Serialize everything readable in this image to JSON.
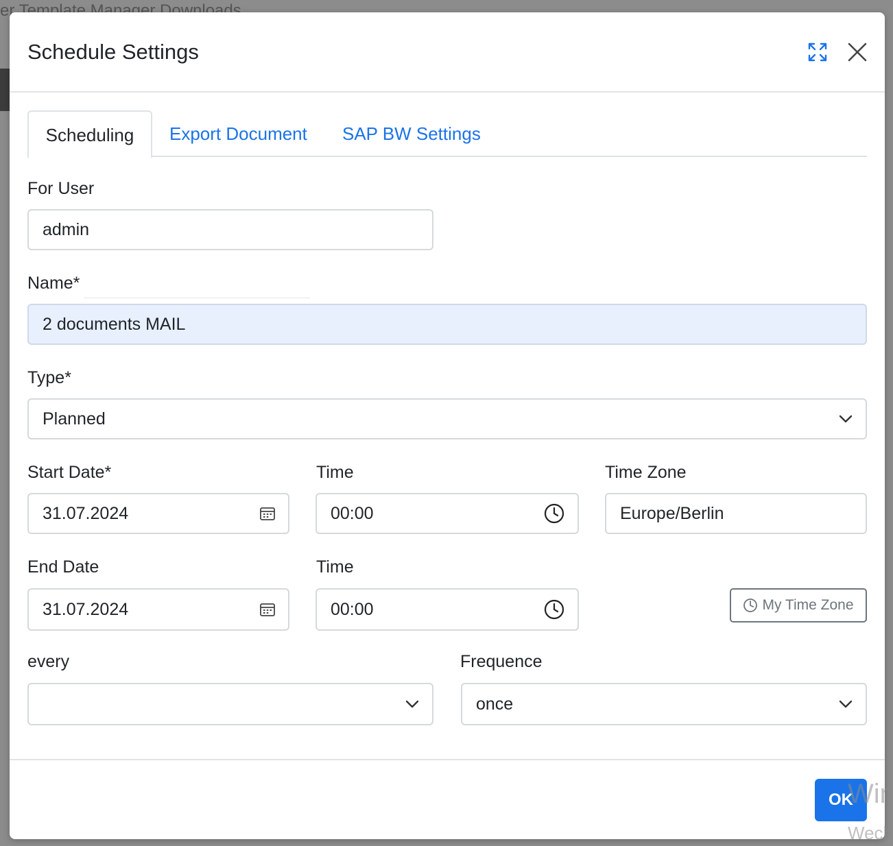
{
  "background": {
    "breadcrumb": "er Template Manager Downloads"
  },
  "modal": {
    "title": "Schedule Settings",
    "tabs": [
      {
        "label": "Scheduling",
        "active": true
      },
      {
        "label": "Export Document",
        "active": false
      },
      {
        "label": "SAP BW Settings",
        "active": false
      }
    ],
    "for_user": {
      "label": "For User",
      "value": "admin"
    },
    "name": {
      "label": "Name*",
      "value": "2 documents MAIL"
    },
    "type": {
      "label": "Type*",
      "value": "Planned"
    },
    "start_date": {
      "label": "Start Date*",
      "value": "31.07.2024"
    },
    "start_time": {
      "label": "Time",
      "value": "00:00"
    },
    "time_zone": {
      "label": "Time Zone",
      "value": "Europe/Berlin"
    },
    "end_date": {
      "label": "End Date",
      "value": "31.07.2024"
    },
    "end_time": {
      "label": "Time",
      "value": "00:00"
    },
    "my_time_zone_button": "My Time Zone",
    "every": {
      "label": "every",
      "value": ""
    },
    "frequence": {
      "label": "Frequence",
      "value": "once"
    },
    "ok_button": "OK"
  },
  "watermark": {
    "line1": "Win",
    "line2": "Wech"
  },
  "colors": {
    "accent": "#1a73e8",
    "highlight_field": "#e8f0fe",
    "backdrop": "#8c8c8c"
  }
}
